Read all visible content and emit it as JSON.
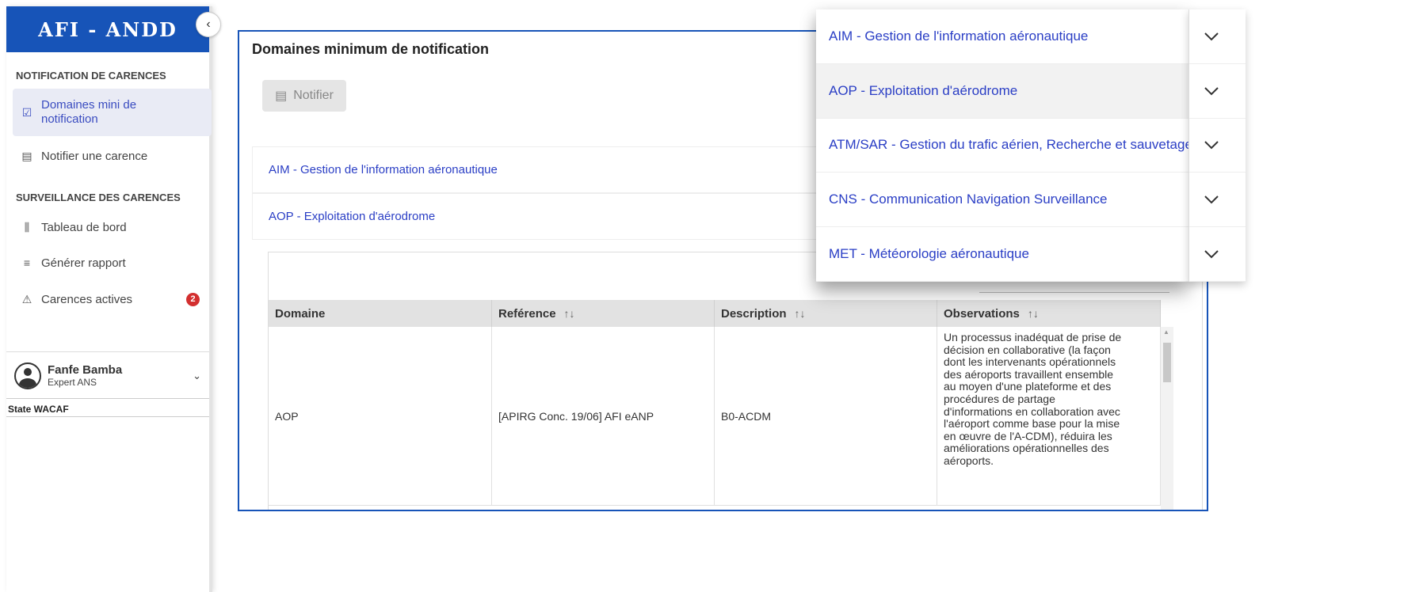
{
  "sidebar": {
    "brand": "AFI - ANDD",
    "collapse_icon": "‹",
    "sections": [
      {
        "title": "NOTIFICATION DE CARENCES"
      },
      {
        "title": "SURVEILLANCE DES CARENCES"
      }
    ],
    "items": [
      {
        "label": "Domaines mini de notification",
        "icon": "checkbox-icon"
      },
      {
        "label": "Notifier une carence",
        "icon": "calendar-icon"
      },
      {
        "label": "Tableau de bord",
        "icon": "bar-chart-icon"
      },
      {
        "label": "Générer rapport",
        "icon": "report-lines-icon"
      },
      {
        "label": "Carences actives",
        "icon": "warning-icon",
        "badge": "2"
      }
    ],
    "profile": {
      "name": "Fanfe Bamba",
      "role": "Expert ANS"
    },
    "state": "State WACAF"
  },
  "main": {
    "title": "Domaines minimum de notification",
    "notify_label": "Notifier",
    "accordion": [
      {
        "label": "AIM - Gestion de l'information aéronautique"
      },
      {
        "label": "AOP - Exploitation d'aérodrome"
      }
    ],
    "table": {
      "columns": [
        "Domaine",
        "Reférence",
        "Description",
        "Observations"
      ],
      "sort_icon": "↑↓",
      "rows": [
        {
          "domaine": "AOP",
          "reference": "[APIRG Conc. 19/06] AFI eANP",
          "description": "B0-ACDM",
          "observations": [
            "Un processus inadéquat de prise de",
            "décision en collaborative (la façon",
            "dont les intervenants opérationnels",
            "des aéroports travaillent ensemble",
            "au moyen d'une plateforme et des",
            "procédures de partage",
            "d'informations en collaboration avec",
            "l'aéroport comme base pour la mise",
            "en œuvre de l'A-CDM), réduira les",
            "améliorations opérationnelles des",
            "aéroports."
          ]
        }
      ]
    }
  },
  "dropdown": {
    "items": [
      {
        "label": "AIM - Gestion de l'information aéronautique"
      },
      {
        "label": "AOP - Exploitation d'aérodrome"
      },
      {
        "label": "ATM/SAR - Gestion du trafic aérien, Recherche et sauvetage"
      },
      {
        "label": "CNS - Communication Navigation Surveillance"
      },
      {
        "label": "MET - Météorologie aéronautique"
      }
    ]
  },
  "colors": {
    "brand_blue": "#1754b8",
    "link_blue": "#2a3ec5",
    "badge_red": "#d32f2f",
    "active_bg": "#e9ebf5"
  }
}
